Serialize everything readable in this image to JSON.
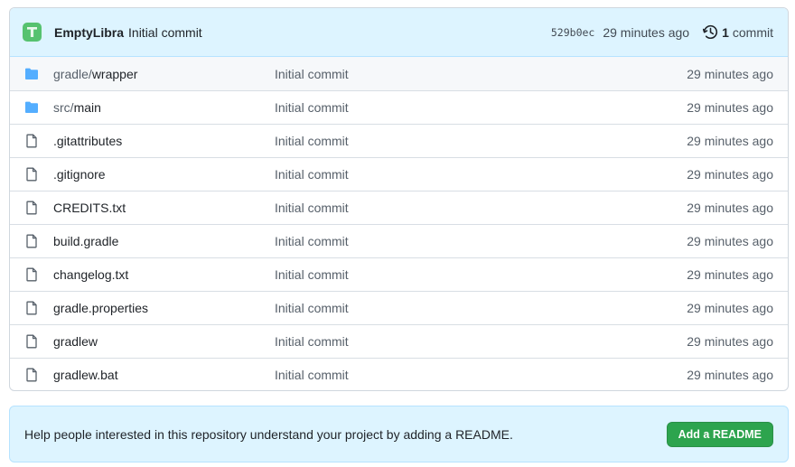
{
  "last_commit": {
    "author": "EmptyLibra",
    "message": "Initial commit",
    "sha": "529b0ec",
    "age": "29 minutes ago",
    "commit_count": "1",
    "commit_label": "commit",
    "history_icon": "history-icon",
    "avatar_color": "#56c26f"
  },
  "files": [
    {
      "type": "dir",
      "prefix": "gradle/",
      "name": "wrapper",
      "message": "Initial commit",
      "age": "29 minutes ago",
      "icon": "folder-icon"
    },
    {
      "type": "dir",
      "prefix": "src/",
      "name": "main",
      "message": "Initial commit",
      "age": "29 minutes ago",
      "icon": "folder-icon"
    },
    {
      "type": "file",
      "prefix": "",
      "name": ".gitattributes",
      "message": "Initial commit",
      "age": "29 minutes ago",
      "icon": "file-icon"
    },
    {
      "type": "file",
      "prefix": "",
      "name": ".gitignore",
      "message": "Initial commit",
      "age": "29 minutes ago",
      "icon": "file-icon"
    },
    {
      "type": "file",
      "prefix": "",
      "name": "CREDITS.txt",
      "message": "Initial commit",
      "age": "29 minutes ago",
      "icon": "file-icon"
    },
    {
      "type": "file",
      "prefix": "",
      "name": "build.gradle",
      "message": "Initial commit",
      "age": "29 minutes ago",
      "icon": "file-icon"
    },
    {
      "type": "file",
      "prefix": "",
      "name": "changelog.txt",
      "message": "Initial commit",
      "age": "29 minutes ago",
      "icon": "file-icon"
    },
    {
      "type": "file",
      "prefix": "",
      "name": "gradle.properties",
      "message": "Initial commit",
      "age": "29 minutes ago",
      "icon": "file-icon"
    },
    {
      "type": "file",
      "prefix": "",
      "name": "gradlew",
      "message": "Initial commit",
      "age": "29 minutes ago",
      "icon": "file-icon"
    },
    {
      "type": "file",
      "prefix": "",
      "name": "gradlew.bat",
      "message": "Initial commit",
      "age": "29 minutes ago",
      "icon": "file-icon"
    }
  ],
  "readme_banner": {
    "text": "Help people interested in this repository understand your project by adding a README.",
    "button_label": "Add a README",
    "button_color": "#2da44e"
  },
  "colors": {
    "folder": "#54aeff",
    "file_icon": "#57606a",
    "banner_bg": "#ddf4ff"
  }
}
